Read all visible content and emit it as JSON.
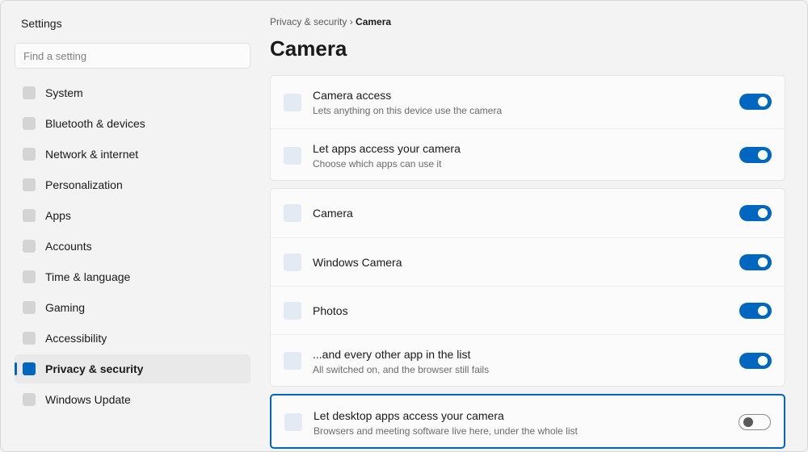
{
  "sidebar": {
    "app_title": "Settings",
    "search_placeholder": "Find a setting",
    "items": [
      {
        "label": "System"
      },
      {
        "label": "Bluetooth & devices"
      },
      {
        "label": "Network & internet"
      },
      {
        "label": "Personalization"
      },
      {
        "label": "Apps"
      },
      {
        "label": "Accounts"
      },
      {
        "label": "Time & language"
      },
      {
        "label": "Gaming"
      },
      {
        "label": "Accessibility"
      },
      {
        "label": "Privacy & security",
        "active": true
      },
      {
        "label": "Windows Update"
      }
    ]
  },
  "breadcrumb": {
    "parent": "Privacy & security",
    "separator": "›",
    "current": "Camera"
  },
  "page_title": "Camera",
  "cards": [
    {
      "rows": [
        {
          "title": "Camera access",
          "subtitle": "Lets anything on this device use the camera",
          "toggle": "on"
        },
        {
          "title": "Let apps access your camera",
          "subtitle": "Choose which apps can use it",
          "toggle": "on"
        }
      ]
    },
    {
      "rows": [
        {
          "title": "Camera",
          "toggle": "on"
        },
        {
          "title": "Windows Camera",
          "toggle": "on"
        },
        {
          "title": "Photos",
          "toggle": "on"
        },
        {
          "title": "...and every other app in the list",
          "subtitle": "All switched on, and the browser still fails",
          "toggle": "on"
        }
      ]
    },
    {
      "rows": [
        {
          "title": "Let desktop apps access your camera",
          "subtitle": "Browsers and meeting software live here, under the whole list",
          "toggle": "off"
        }
      ]
    }
  ],
  "colors": {
    "accent": "#0067c0",
    "background": "#f3f3f3",
    "card": "#fbfbfb"
  },
  "icons": {
    "nav_item": "square-placeholder-icon",
    "row_item": "square-placeholder-icon"
  }
}
